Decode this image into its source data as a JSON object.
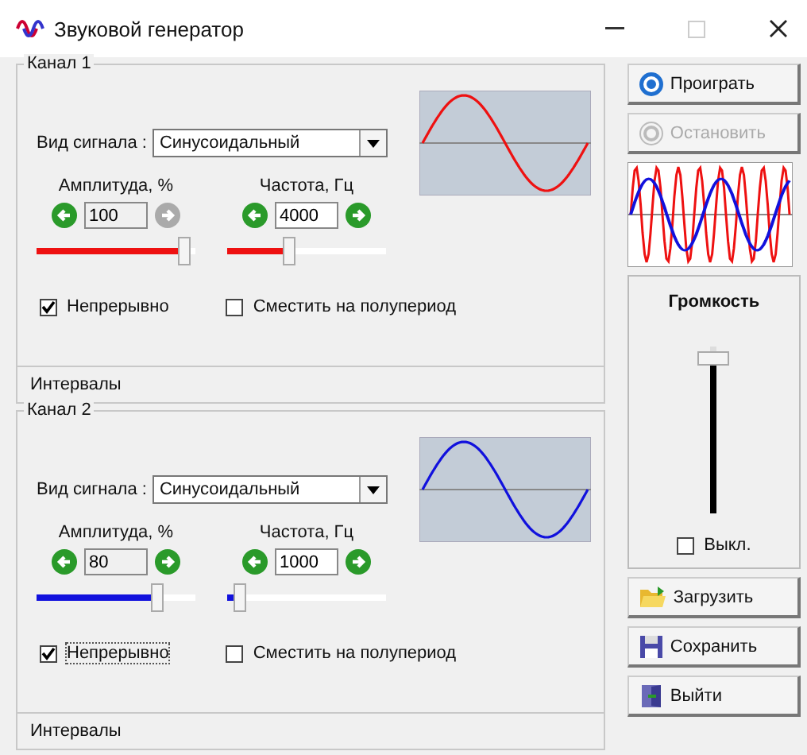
{
  "window": {
    "title": "Звуковой генератор"
  },
  "channels": [
    {
      "name": "Канал 1",
      "color": "#ee1111",
      "signal_label": "Вид сигнала :",
      "signal_value": "Синусоидальный",
      "amplitude": {
        "label": "Амплитуда, %",
        "value": "100",
        "level": 0.97,
        "decrease_disabled": false,
        "increase_disabled": true
      },
      "frequency": {
        "label": "Частота, Гц",
        "value": "4000",
        "level": 0.38,
        "decrease_disabled": false,
        "increase_disabled": false
      },
      "continuous": {
        "label": "Непрерывно",
        "checked": true
      },
      "shift": {
        "label": "Сместить на полупериод",
        "checked": false
      },
      "intervals": "Интервалы"
    },
    {
      "name": "Канал 2",
      "color": "#1111dd",
      "signal_label": "Вид сигнала :",
      "signal_value": "Синусоидальный",
      "amplitude": {
        "label": "Амплитуда, %",
        "value": "80",
        "level": 0.78,
        "decrease_disabled": false,
        "increase_disabled": false
      },
      "frequency": {
        "label": "Частота, Гц",
        "value": "1000",
        "level": 0.04,
        "decrease_disabled": false,
        "increase_disabled": false
      },
      "continuous": {
        "label": "Непрерывно",
        "checked": true
      },
      "shift": {
        "label": "Сместить на полупериод",
        "checked": false
      },
      "intervals": "Интервалы"
    }
  ],
  "top_buttons": [
    {
      "kind": "play",
      "label": "Проиграть",
      "disabled": false
    },
    {
      "kind": "stop",
      "label": "Остановить",
      "disabled": true
    }
  ],
  "volume": {
    "title": "Громкость",
    "level": 0.97,
    "mute": {
      "label": "Выкл.",
      "checked": false
    }
  },
  "bottom_buttons": [
    {
      "kind": "load",
      "label": "Загрузить",
      "disabled": false
    },
    {
      "kind": "save",
      "label": "Сохранить",
      "disabled": false
    },
    {
      "kind": "exit",
      "label": "Выйти",
      "disabled": false
    }
  ]
}
